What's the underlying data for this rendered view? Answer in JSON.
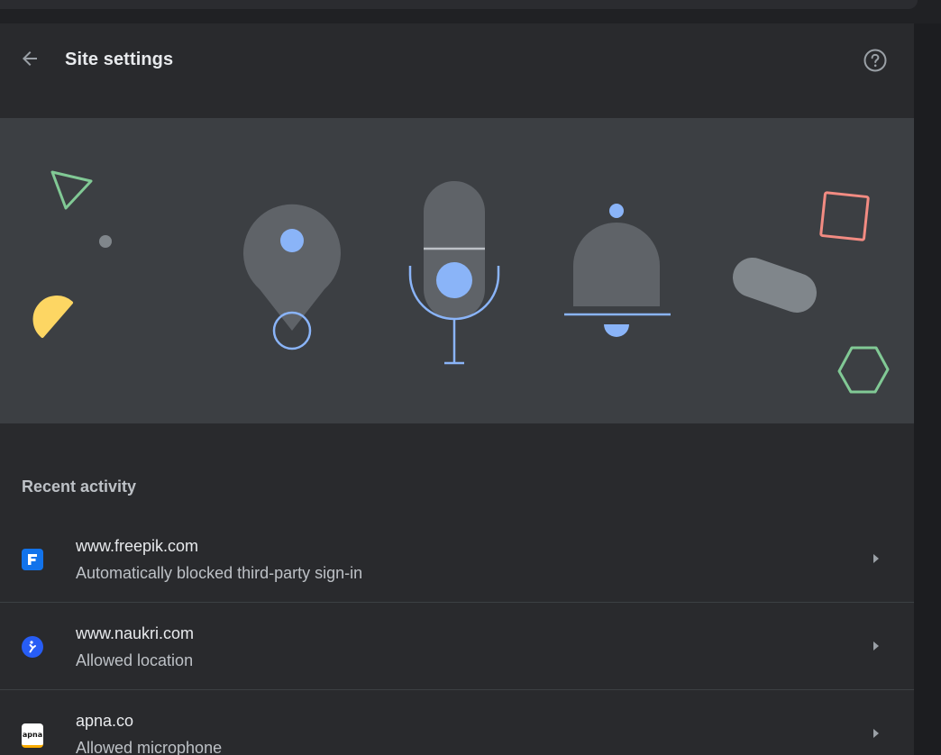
{
  "header": {
    "title": "Site settings",
    "back_icon": "arrow-back-icon",
    "help_icon": "help-circle-icon"
  },
  "banner": {
    "illustration": [
      "location-pin-icon",
      "microphone-icon",
      "notification-bell-icon"
    ]
  },
  "recent_activity": {
    "title": "Recent activity",
    "items": [
      {
        "site": "www.freepik.com",
        "description": "Automatically blocked third-party sign-in",
        "favicon": "freepik-favicon",
        "favicon_color": "#1273eb"
      },
      {
        "site": "www.naukri.com",
        "description": "Allowed location",
        "favicon": "naukri-favicon",
        "favicon_color": "#275df5"
      },
      {
        "site": "apna.co",
        "description": "Allowed microphone",
        "favicon": "apna-favicon",
        "favicon_text": "apna",
        "favicon_color": "#ffffff"
      }
    ]
  },
  "colors": {
    "accent_blue": "#8ab4f8",
    "background": "#292a2d",
    "banner": "#3c3f43"
  }
}
